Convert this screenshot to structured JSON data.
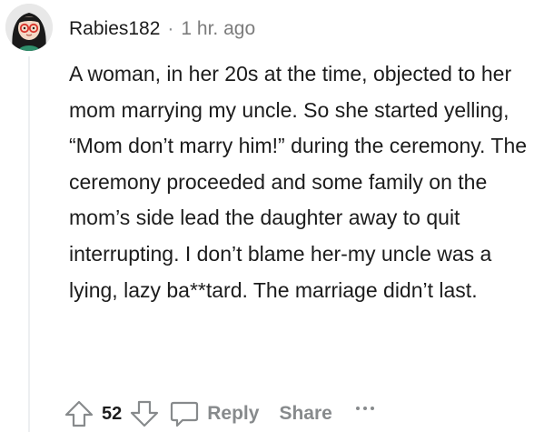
{
  "comment": {
    "username": "Rabies182",
    "separator": "·",
    "timestamp": "1 hr. ago",
    "body": "A woman, in her 20s at the time, objected to her mom marrying my uncle. So she started yelling, “Mom don’t marry him!” during the ceremony. The ceremony proceeded and some family on the mom’s side lead the daughter away to quit interrupting. I don’t blame her-my uncle was a lying, lazy ba**tard. The marriage didn’t last."
  },
  "actions": {
    "upvote_icon": "upvote-arrow-icon",
    "vote_count": "52",
    "downvote_icon": "downvote-arrow-icon",
    "reply_icon": "speech-bubble-icon",
    "reply_label": "Reply",
    "share_label": "Share",
    "more_icon": "ellipsis-icon"
  },
  "colors": {
    "text": "#1c1c1c",
    "muted": "#878a8c",
    "thread_line": "#edeff1"
  }
}
